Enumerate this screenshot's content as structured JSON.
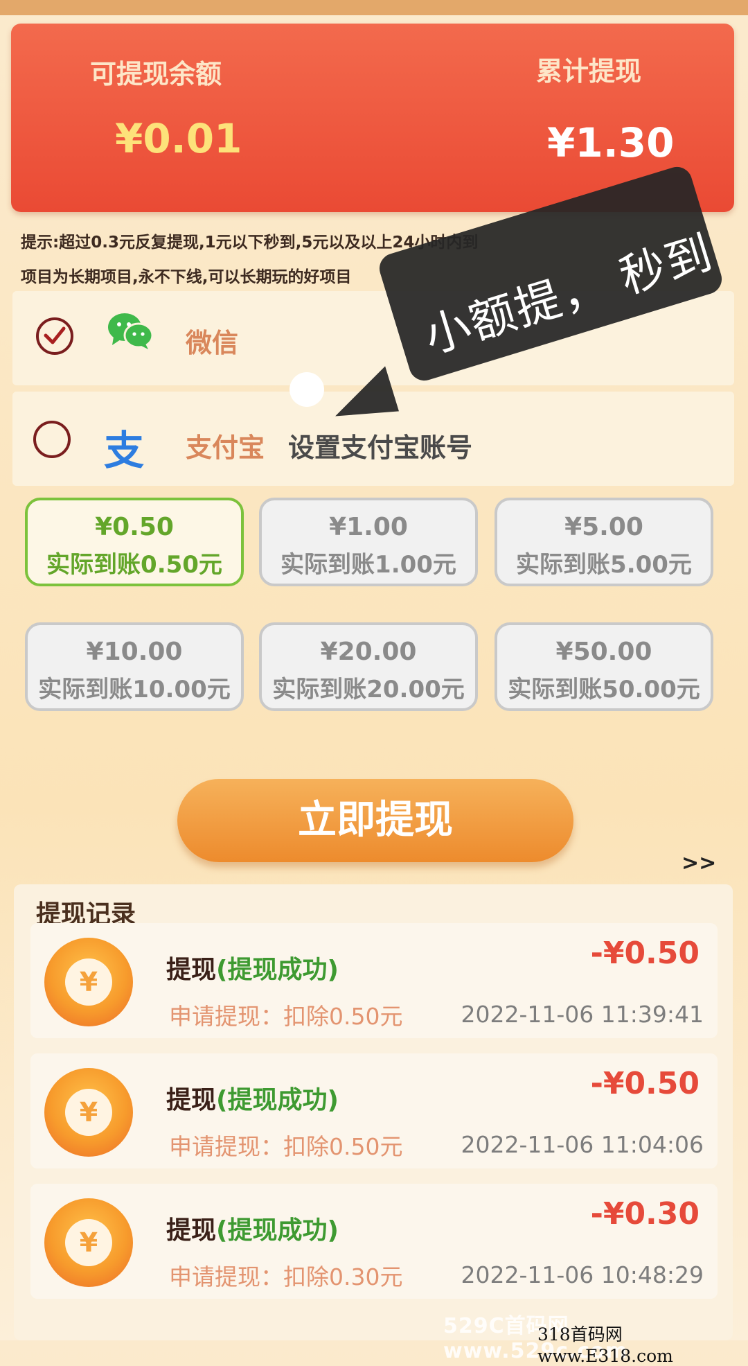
{
  "balance": {
    "available_label": "可提现余额",
    "available_value": "¥0.01",
    "total_label": "累计提现",
    "total_value": "¥1.30"
  },
  "tips": {
    "line1": "提示:超过0.3元反复提现,1元以下秒到,5元以及以上24小时内到",
    "line2": "项目为长期项目,永不下线,可以长期玩的好项目"
  },
  "payment_methods": [
    {
      "name": "微信",
      "icon": "wechat-icon",
      "selected": true,
      "sub": ""
    },
    {
      "name": "支付宝",
      "icon": "alipay-icon",
      "selected": false,
      "sub": "设置支付宝账号"
    }
  ],
  "amounts": [
    {
      "amount": "¥0.50",
      "actual": "实际到账0.50元",
      "selected": true
    },
    {
      "amount": "¥1.00",
      "actual": "实际到账1.00元",
      "selected": false
    },
    {
      "amount": "¥5.00",
      "actual": "实际到账5.00元",
      "selected": false
    },
    {
      "amount": "¥10.00",
      "actual": "实际到账10.00元",
      "selected": false
    },
    {
      "amount": "¥20.00",
      "actual": "实际到账20.00元",
      "selected": false
    },
    {
      "amount": "¥50.00",
      "actual": "实际到账50.00元",
      "selected": false
    }
  ],
  "withdraw_button": "立即提现",
  "more_arrow": ">>",
  "records": {
    "title": "提现记录",
    "items": [
      {
        "title": "提现",
        "status": "(提现成功)",
        "desc": "申请提现：扣除0.50元",
        "amount": "-¥0.50",
        "time": "2022-11-06  11:39:41"
      },
      {
        "title": "提现",
        "status": "(提现成功)",
        "desc": "申请提现：扣除0.50元",
        "amount": "-¥0.50",
        "time": "2022-11-06  11:04:06"
      },
      {
        "title": "提现",
        "status": "(提现成功)",
        "desc": "申请提现：扣除0.30元",
        "amount": "-¥0.30",
        "time": "2022-11-06  10:48:29"
      }
    ]
  },
  "coin_symbol": "¥",
  "overlay": {
    "text": "小额提，  秒到"
  },
  "watermark": {
    "line1": "529C首码网  www.529c.com",
    "line2": "318首码网  www.E318.com"
  },
  "colors": {
    "card_red": "#ea4a34",
    "balance_value_gold": "#fde27a",
    "selected_green": "#63a62a",
    "button_orange": "#ed8b2d",
    "record_amount_red": "#e64a3a"
  }
}
